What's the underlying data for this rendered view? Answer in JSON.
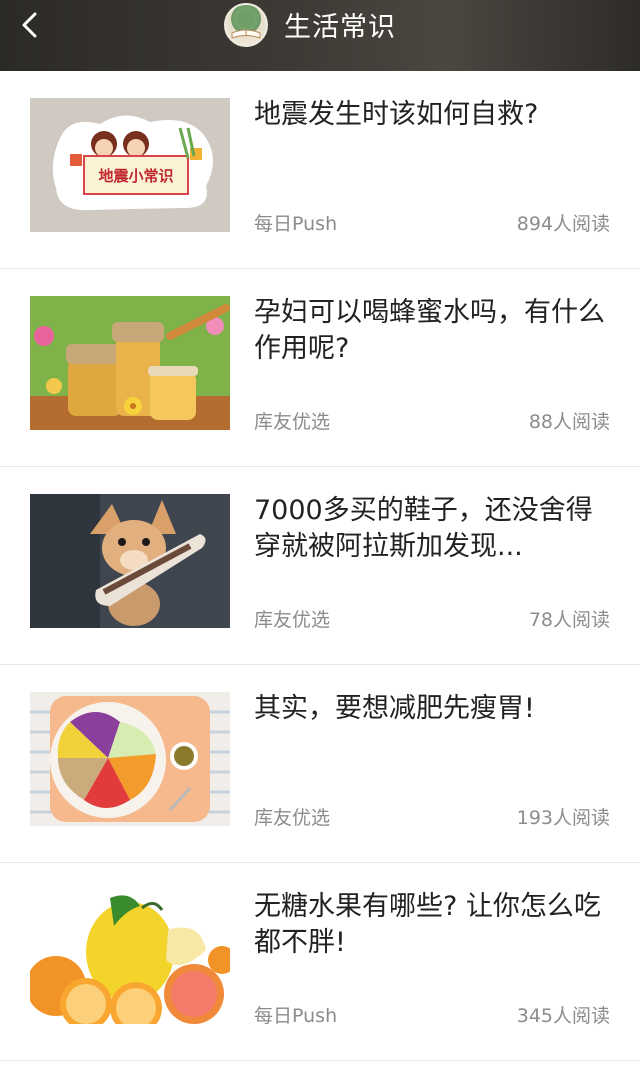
{
  "header": {
    "title": "生活常识",
    "back_icon": "chevron-left-icon",
    "avatar_icon": "book-avatar-icon"
  },
  "articles": [
    {
      "title": "地震发生时该如何自救?",
      "source": "每日Push",
      "reads": "894人阅读"
    },
    {
      "title": "孕妇可以喝蜂蜜水吗，有什么作用呢?",
      "source": "库友优选",
      "reads": "88人阅读"
    },
    {
      "title": "7000多买的鞋子，还没舍得穿就被阿拉斯加发现...",
      "source": "库友优选",
      "reads": "78人阅读"
    },
    {
      "title": "其实，要想减肥先瘦胃!",
      "source": "库友优选",
      "reads": "193人阅读"
    },
    {
      "title": "无糖水果有哪些? 让你怎么吃都不胖!",
      "source": "每日Push",
      "reads": "345人阅读"
    }
  ],
  "thumbnail_labels": {
    "earthquake": "地震小常识"
  },
  "colors": {
    "header_bg": "#3a3732",
    "title_text": "#222222",
    "meta_text": "#8c8c8c",
    "divider": "#e6e6e6"
  }
}
